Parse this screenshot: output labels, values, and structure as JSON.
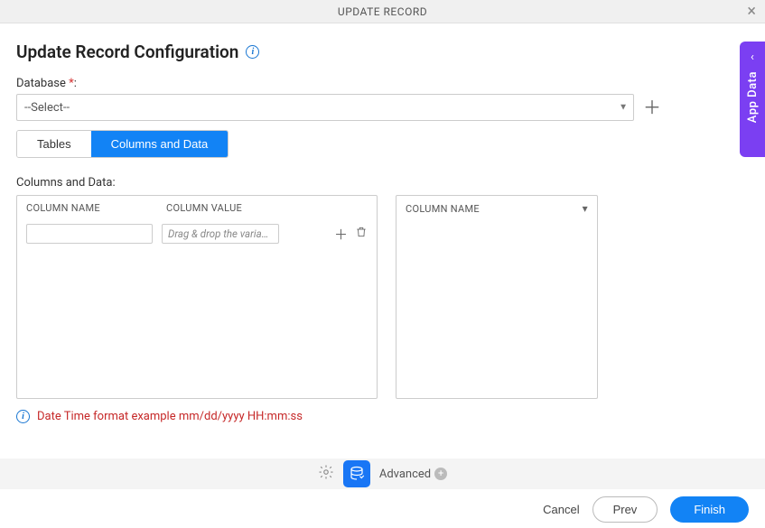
{
  "header": {
    "title": "UPDATE RECORD"
  },
  "page": {
    "title": "Update Record Configuration"
  },
  "database": {
    "label": "Database",
    "required_marker": "*",
    "colon": ":",
    "selected": "--Select--"
  },
  "tabs": {
    "tables": "Tables",
    "columns": "Columns and Data"
  },
  "section": {
    "label": "Columns and Data:"
  },
  "left_panel": {
    "col_name_header": "COLUMN NAME",
    "col_value_header": "COLUMN VALUE",
    "drop_placeholder": "Drag & drop the varia…"
  },
  "right_panel": {
    "col_name_header": "COLUMN NAME"
  },
  "hint": {
    "text": "Date Time format example mm/dd/yyyy HH:mm:ss"
  },
  "side": {
    "label": "App Data"
  },
  "toolbar": {
    "advanced": "Advanced"
  },
  "footer": {
    "cancel": "Cancel",
    "prev": "Prev",
    "finish": "Finish"
  }
}
